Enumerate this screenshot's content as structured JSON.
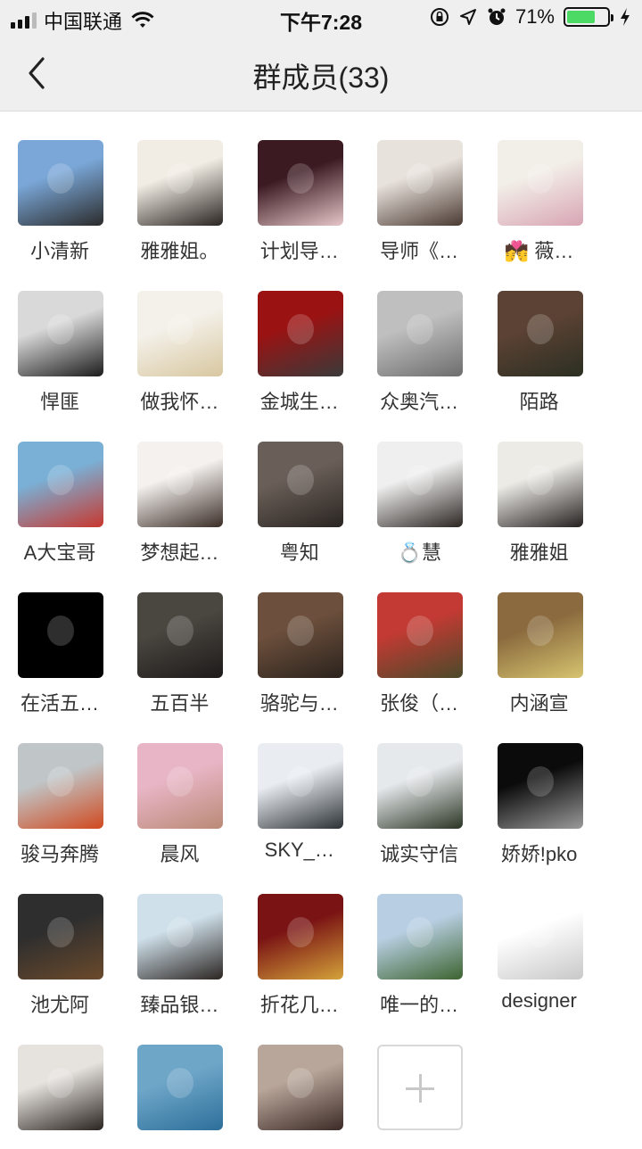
{
  "status": {
    "carrier": "中国联通",
    "time": "下午7:28",
    "battery_pct": "71%",
    "battery_level": 0.71,
    "battery_color": "#4cd964"
  },
  "nav": {
    "title": "群成员(33)",
    "back_icon": "chevron-left-icon"
  },
  "members": [
    {
      "name": "小清新",
      "colors": [
        "#7aa7d8",
        "#2b2b2b"
      ]
    },
    {
      "name": "雅雅姐。",
      "colors": [
        "#f2ede4",
        "#2a2422"
      ]
    },
    {
      "name": "计划导…",
      "colors": [
        "#3b1a22",
        "#e6c6c8"
      ]
    },
    {
      "name": "导师《…",
      "colors": [
        "#e8e2dc",
        "#4a3a32"
      ]
    },
    {
      "name": "💏 薇…",
      "colors": [
        "#f2eee8",
        "#d8a5b4"
      ]
    },
    {
      "name": "悍匪",
      "colors": [
        "#d9d9d9",
        "#1c1c1c"
      ]
    },
    {
      "name": "做我怀…",
      "colors": [
        "#f4f1ea",
        "#d8c7a0"
      ]
    },
    {
      "name": "金城生…",
      "colors": [
        "#9a1212",
        "#3a3a3a"
      ]
    },
    {
      "name": "众奥汽…",
      "colors": [
        "#bfbfbf",
        "#6d6d6d"
      ]
    },
    {
      "name": "陌路",
      "colors": [
        "#5c4234",
        "#2b2f22"
      ]
    },
    {
      "name": "A大宝哥",
      "colors": [
        "#7ab0d6",
        "#c8372e"
      ]
    },
    {
      "name": "梦想起…",
      "colors": [
        "#f4f1ee",
        "#3c2e28"
      ]
    },
    {
      "name": "粤知",
      "colors": [
        "#6a5f58",
        "#2a2522"
      ]
    },
    {
      "name": "💍慧",
      "colors": [
        "#efefef",
        "#2c2622"
      ]
    },
    {
      "name": "雅雅姐",
      "colors": [
        "#ecebe6",
        "#262120"
      ]
    },
    {
      "name": "在活五…",
      "colors": [
        "#000000",
        "#000000"
      ]
    },
    {
      "name": "五百半",
      "colors": [
        "#4a4640",
        "#1d1b1a"
      ]
    },
    {
      "name": "骆驼与…",
      "colors": [
        "#6c4f3c",
        "#2b231d"
      ]
    },
    {
      "name": "张俊（…",
      "colors": [
        "#c23a33",
        "#4b4a2a"
      ]
    },
    {
      "name": "内涵宣",
      "colors": [
        "#8a6a3e",
        "#d6c36f"
      ]
    },
    {
      "name": "骏马奔腾",
      "colors": [
        "#c0c6c8",
        "#d0491f"
      ]
    },
    {
      "name": "晨风",
      "colors": [
        "#e8b5c6",
        "#ba8a76"
      ]
    },
    {
      "name": "SKY_…",
      "colors": [
        "#e9edf2",
        "#2c3136"
      ]
    },
    {
      "name": "诚实守信",
      "colors": [
        "#e6e9ec",
        "#2b3524"
      ]
    },
    {
      "name": "娇娇!pko",
      "colors": [
        "#0b0b0b",
        "#9a9a9a"
      ]
    },
    {
      "name": "池尤阿",
      "colors": [
        "#2e2e2e",
        "#6b4a2c"
      ]
    },
    {
      "name": "臻品银…",
      "colors": [
        "#cfe0ea",
        "#2b2522"
      ]
    },
    {
      "name": "折花几…",
      "colors": [
        "#7a1414",
        "#d4a23a"
      ]
    },
    {
      "name": "唯一的…",
      "colors": [
        "#b8cfe3",
        "#3d6430"
      ]
    },
    {
      "name": "designer",
      "colors": [
        "#ffffff",
        "#c8c8c8"
      ]
    },
    {
      "name": "",
      "colors": [
        "#e6e2de",
        "#2a2420"
      ]
    },
    {
      "name": "",
      "colors": [
        "#6ea6c8",
        "#2d6f9a"
      ]
    },
    {
      "name": "",
      "colors": [
        "#b9a69a",
        "#3b2a26"
      ]
    }
  ],
  "add_button_icon": "plus-icon"
}
